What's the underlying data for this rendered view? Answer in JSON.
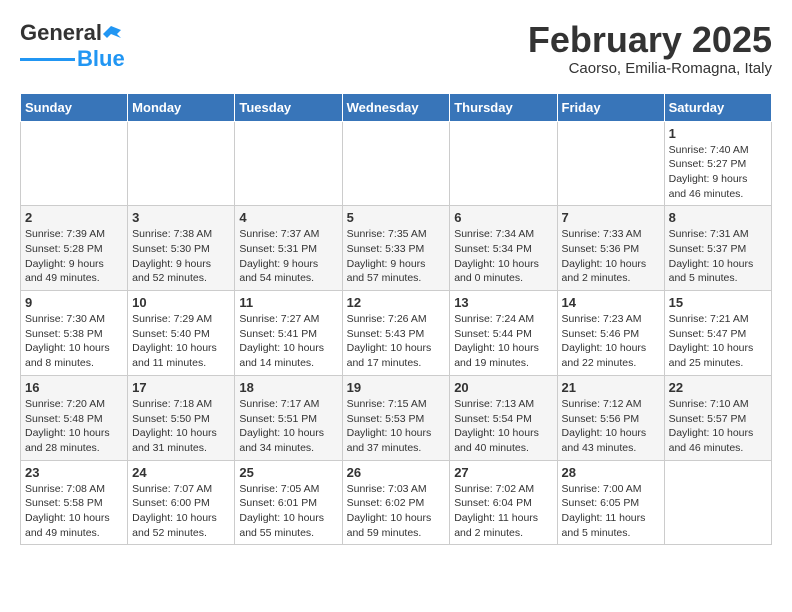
{
  "header": {
    "logo_general": "General",
    "logo_blue": "Blue",
    "title": "February 2025",
    "subtitle": "Caorso, Emilia-Romagna, Italy"
  },
  "calendar": {
    "days_of_week": [
      "Sunday",
      "Monday",
      "Tuesday",
      "Wednesday",
      "Thursday",
      "Friday",
      "Saturday"
    ],
    "weeks": [
      [
        {
          "day": "",
          "info": ""
        },
        {
          "day": "",
          "info": ""
        },
        {
          "day": "",
          "info": ""
        },
        {
          "day": "",
          "info": ""
        },
        {
          "day": "",
          "info": ""
        },
        {
          "day": "",
          "info": ""
        },
        {
          "day": "1",
          "info": "Sunrise: 7:40 AM\nSunset: 5:27 PM\nDaylight: 9 hours and 46 minutes."
        }
      ],
      [
        {
          "day": "2",
          "info": "Sunrise: 7:39 AM\nSunset: 5:28 PM\nDaylight: 9 hours and 49 minutes."
        },
        {
          "day": "3",
          "info": "Sunrise: 7:38 AM\nSunset: 5:30 PM\nDaylight: 9 hours and 52 minutes."
        },
        {
          "day": "4",
          "info": "Sunrise: 7:37 AM\nSunset: 5:31 PM\nDaylight: 9 hours and 54 minutes."
        },
        {
          "day": "5",
          "info": "Sunrise: 7:35 AM\nSunset: 5:33 PM\nDaylight: 9 hours and 57 minutes."
        },
        {
          "day": "6",
          "info": "Sunrise: 7:34 AM\nSunset: 5:34 PM\nDaylight: 10 hours and 0 minutes."
        },
        {
          "day": "7",
          "info": "Sunrise: 7:33 AM\nSunset: 5:36 PM\nDaylight: 10 hours and 2 minutes."
        },
        {
          "day": "8",
          "info": "Sunrise: 7:31 AM\nSunset: 5:37 PM\nDaylight: 10 hours and 5 minutes."
        }
      ],
      [
        {
          "day": "9",
          "info": "Sunrise: 7:30 AM\nSunset: 5:38 PM\nDaylight: 10 hours and 8 minutes."
        },
        {
          "day": "10",
          "info": "Sunrise: 7:29 AM\nSunset: 5:40 PM\nDaylight: 10 hours and 11 minutes."
        },
        {
          "day": "11",
          "info": "Sunrise: 7:27 AM\nSunset: 5:41 PM\nDaylight: 10 hours and 14 minutes."
        },
        {
          "day": "12",
          "info": "Sunrise: 7:26 AM\nSunset: 5:43 PM\nDaylight: 10 hours and 17 minutes."
        },
        {
          "day": "13",
          "info": "Sunrise: 7:24 AM\nSunset: 5:44 PM\nDaylight: 10 hours and 19 minutes."
        },
        {
          "day": "14",
          "info": "Sunrise: 7:23 AM\nSunset: 5:46 PM\nDaylight: 10 hours and 22 minutes."
        },
        {
          "day": "15",
          "info": "Sunrise: 7:21 AM\nSunset: 5:47 PM\nDaylight: 10 hours and 25 minutes."
        }
      ],
      [
        {
          "day": "16",
          "info": "Sunrise: 7:20 AM\nSunset: 5:48 PM\nDaylight: 10 hours and 28 minutes."
        },
        {
          "day": "17",
          "info": "Sunrise: 7:18 AM\nSunset: 5:50 PM\nDaylight: 10 hours and 31 minutes."
        },
        {
          "day": "18",
          "info": "Sunrise: 7:17 AM\nSunset: 5:51 PM\nDaylight: 10 hours and 34 minutes."
        },
        {
          "day": "19",
          "info": "Sunrise: 7:15 AM\nSunset: 5:53 PM\nDaylight: 10 hours and 37 minutes."
        },
        {
          "day": "20",
          "info": "Sunrise: 7:13 AM\nSunset: 5:54 PM\nDaylight: 10 hours and 40 minutes."
        },
        {
          "day": "21",
          "info": "Sunrise: 7:12 AM\nSunset: 5:56 PM\nDaylight: 10 hours and 43 minutes."
        },
        {
          "day": "22",
          "info": "Sunrise: 7:10 AM\nSunset: 5:57 PM\nDaylight: 10 hours and 46 minutes."
        }
      ],
      [
        {
          "day": "23",
          "info": "Sunrise: 7:08 AM\nSunset: 5:58 PM\nDaylight: 10 hours and 49 minutes."
        },
        {
          "day": "24",
          "info": "Sunrise: 7:07 AM\nSunset: 6:00 PM\nDaylight: 10 hours and 52 minutes."
        },
        {
          "day": "25",
          "info": "Sunrise: 7:05 AM\nSunset: 6:01 PM\nDaylight: 10 hours and 55 minutes."
        },
        {
          "day": "26",
          "info": "Sunrise: 7:03 AM\nSunset: 6:02 PM\nDaylight: 10 hours and 59 minutes."
        },
        {
          "day": "27",
          "info": "Sunrise: 7:02 AM\nSunset: 6:04 PM\nDaylight: 11 hours and 2 minutes."
        },
        {
          "day": "28",
          "info": "Sunrise: 7:00 AM\nSunset: 6:05 PM\nDaylight: 11 hours and 5 minutes."
        },
        {
          "day": "",
          "info": ""
        }
      ]
    ]
  }
}
